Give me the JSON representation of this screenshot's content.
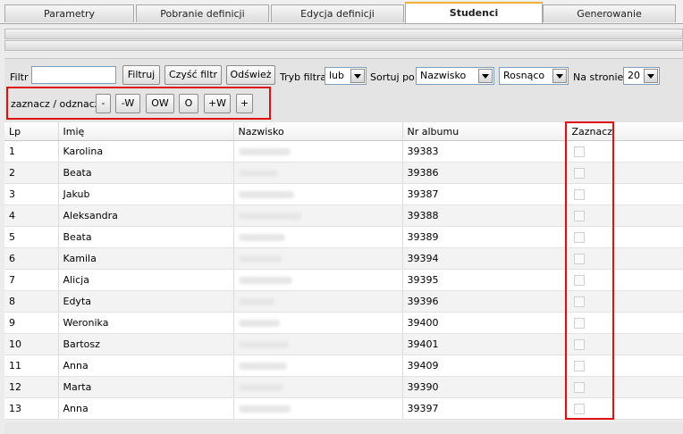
{
  "tabs": [
    {
      "label": "Parametry"
    },
    {
      "label": "Pobranie definicji"
    },
    {
      "label": "Edycja definicji"
    },
    {
      "label": "Studenci"
    },
    {
      "label": "Generowanie"
    }
  ],
  "toolbar": {
    "filter_label": "Filtr",
    "filter_value": "",
    "filter_button": "Filtruj",
    "clear_button": "Czyść filtr",
    "refresh_button": "Odśwież",
    "mode_label": "Tryb filtra",
    "mode_value": "lub",
    "sort_label": "Sortuj po",
    "sort_value": "Nazwisko",
    "order_value": "Rosnąco",
    "page_label": "Na stronie",
    "page_value": "20"
  },
  "selection": {
    "label": "zaznacz / odznacz",
    "buttons": [
      "-",
      "-W",
      "OW",
      "O",
      "+W",
      "+"
    ]
  },
  "table": {
    "headers": {
      "lp": "Lp",
      "imie": "Imię",
      "nazwisko": "Nazwisko",
      "album": "Nr albumu",
      "zaznacz": "Zaznacz"
    },
    "rows": [
      {
        "lp": "1",
        "imie": "Karolina",
        "album": "39383"
      },
      {
        "lp": "2",
        "imie": "Beata",
        "album": "39386"
      },
      {
        "lp": "3",
        "imie": "Jakub",
        "album": "39387"
      },
      {
        "lp": "4",
        "imie": "Aleksandra",
        "album": "39388"
      },
      {
        "lp": "5",
        "imie": "Beata",
        "album": "39389"
      },
      {
        "lp": "6",
        "imie": "Kamila",
        "album": "39394"
      },
      {
        "lp": "7",
        "imie": "Alicja",
        "album": "39395"
      },
      {
        "lp": "8",
        "imie": "Edyta",
        "album": "39396"
      },
      {
        "lp": "9",
        "imie": "Weronika",
        "album": "39400"
      },
      {
        "lp": "10",
        "imie": "Bartosz",
        "album": "39401"
      },
      {
        "lp": "11",
        "imie": "Anna",
        "album": "39409"
      },
      {
        "lp": "12",
        "imie": "Marta",
        "album": "39390"
      },
      {
        "lp": "13",
        "imie": "Anna",
        "album": "39397"
      }
    ]
  },
  "colors": {
    "highlight": "#e01010",
    "active_tab_accent": "#f0b030"
  }
}
